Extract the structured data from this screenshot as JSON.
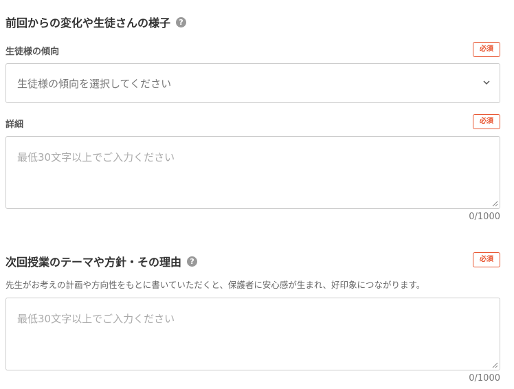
{
  "section1": {
    "title": "前回からの変化や生徒さんの様子",
    "help_glyph": "?",
    "tendency": {
      "label": "生徒様の傾向",
      "required": "必須",
      "select_value": "生徒様の傾向を選択してください"
    },
    "details": {
      "label": "詳細",
      "required": "必須",
      "placeholder": "最低30文字以上でご入力ください",
      "counter": "0/1000"
    }
  },
  "section2": {
    "title": "次回授業のテーマや方針・その理由",
    "help_glyph": "?",
    "required": "必須",
    "hint": "先生がお考えの計画や方向性をもとに書いていただくと、保護者に安心感が生まれ、好印象につながります。",
    "placeholder": "最低30文字以上でご入力ください",
    "counter": "0/1000"
  },
  "colors": {
    "required_accent": "#e8542f",
    "help_icon": "#999999",
    "border": "#cccccc"
  }
}
